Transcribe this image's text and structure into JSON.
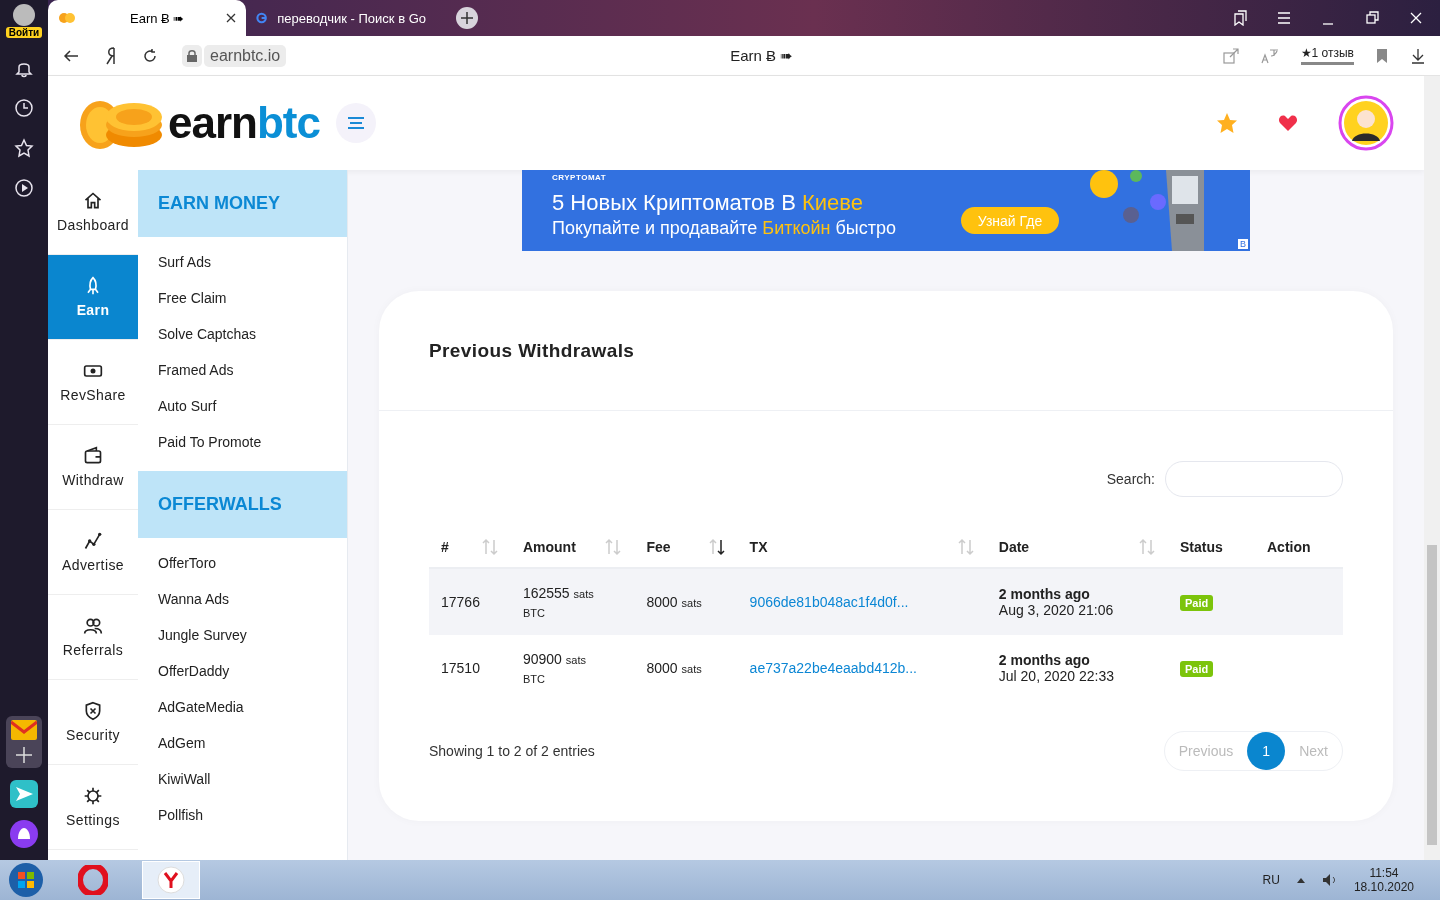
{
  "browser": {
    "profile_label": "Войти",
    "tabs": [
      {
        "title": "Earn Ƀ ➠",
        "selected": true,
        "kind": "site"
      },
      {
        "title": "переводчик - Поиск в Go",
        "selected": false,
        "kind": "google"
      }
    ],
    "address": "earnbtc.io",
    "page_title": "Earn Ƀ ➠",
    "review": "★1 отзыв"
  },
  "site": {
    "logo": {
      "part_1": "earn",
      "part_2": "btc"
    },
    "nav_rail": [
      {
        "label": "Dashboard",
        "selected": false
      },
      {
        "label": "Earn",
        "selected": true
      },
      {
        "label": "RevShare",
        "selected": false
      },
      {
        "label": "Withdraw",
        "selected": false
      },
      {
        "label": "Advertise",
        "selected": false
      },
      {
        "label": "Referrals",
        "selected": false
      },
      {
        "label": "Security",
        "selected": false
      },
      {
        "label": "Settings",
        "selected": false
      }
    ],
    "submenu": [
      {
        "title": "EARN MONEY",
        "items": [
          "Surf Ads",
          "Free Claim",
          "Solve Captchas",
          "Framed Ads",
          "Auto Surf",
          "Paid To Promote"
        ]
      },
      {
        "title": "OFFERWALLS",
        "items": [
          "OfferToro",
          "Wanna Ads",
          "Jungle Survey",
          "OfferDaddy",
          "AdGateMedia",
          "AdGem",
          "KiwiWall",
          "Pollfish"
        ]
      }
    ],
    "ad": {
      "brand": "CRYPTOMAT",
      "headline": "5 Новых Криптоматов В",
      "headline_highlight": "Киеве",
      "subline": "Покупайте и продавайте",
      "subline_highlight": "Биткойн",
      "subline_end": "быстро",
      "button": "Узнай Где",
      "corner_mark": "B"
    },
    "withdrawals": {
      "title": "Previous Withdrawals",
      "search_label": "Search:",
      "columns": [
        {
          "label": "#",
          "sortable": true,
          "sorted_desc": false
        },
        {
          "label": "Amount",
          "sortable": true,
          "sorted_desc": false
        },
        {
          "label": "Fee",
          "sortable": true,
          "sorted_desc": true
        },
        {
          "label": "TX",
          "sortable": true,
          "sorted_desc": false
        },
        {
          "label": "Date",
          "sortable": true,
          "sorted_desc": false
        },
        {
          "label": "Status",
          "sortable": false
        },
        {
          "label": "Action",
          "sortable": false
        }
      ],
      "rows": [
        {
          "id": "17766",
          "amount": "162555",
          "amount_unit": "sats",
          "currency": "BTC",
          "fee": "8000",
          "fee_unit": "sats",
          "tx": "9066de81b048ac1f4d0f...",
          "date_relative": "2 months ago",
          "date": "Aug 3, 2020 21:06",
          "status": "Paid"
        },
        {
          "id": "17510",
          "amount": "90900",
          "amount_unit": "sats",
          "currency": "BTC",
          "fee": "8000",
          "fee_unit": "sats",
          "tx": "ae737a22be4eaabd412b...",
          "date_relative": "2 months ago",
          "date": "Jul 20, 2020 22:33",
          "status": "Paid"
        }
      ],
      "info": "Showing 1 to 2 of 2 entries",
      "pagination": [
        {
          "label": "Previous",
          "kind": "nav",
          "disabled": true,
          "selected": false
        },
        {
          "label": "1",
          "kind": "page",
          "disabled": false,
          "selected": true
        },
        {
          "label": "Next",
          "kind": "nav",
          "disabled": true,
          "selected": false
        }
      ]
    }
  },
  "taskbar": {
    "language": "RU",
    "time": "11:54",
    "date": "18.10.2020"
  }
}
